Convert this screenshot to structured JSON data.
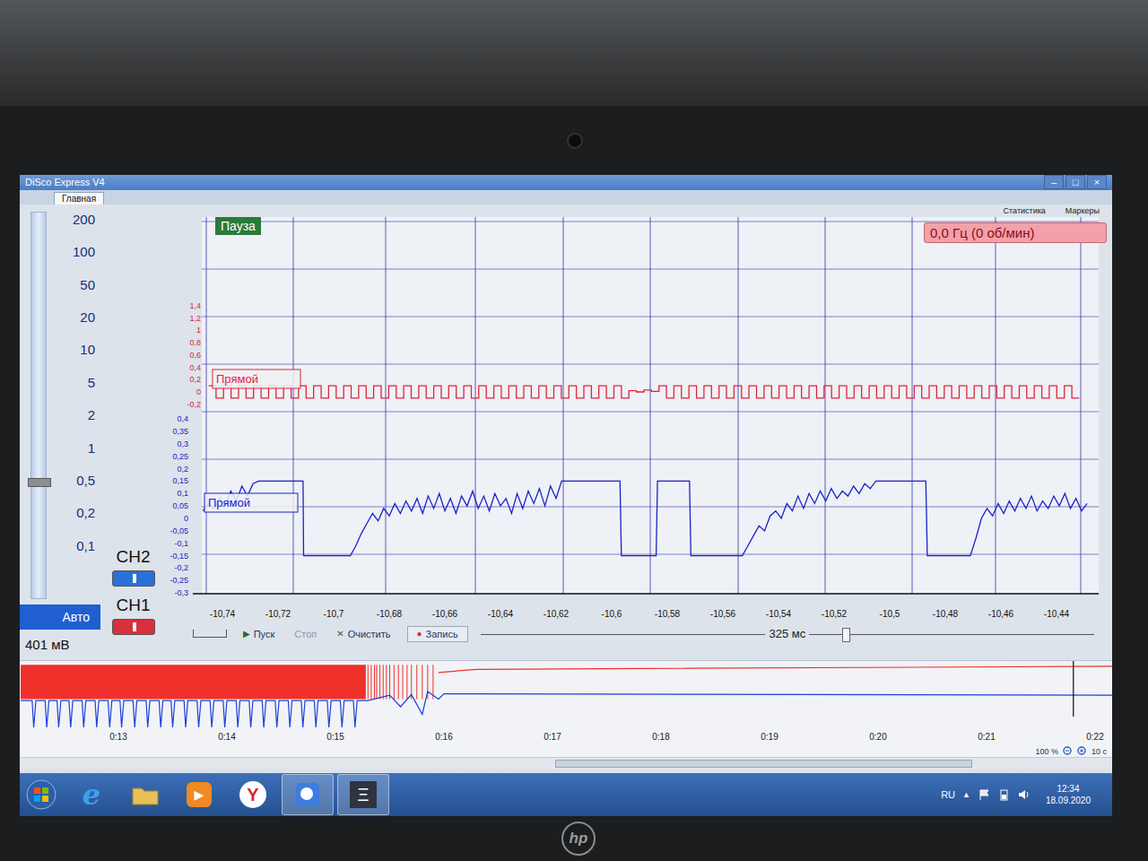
{
  "window": {
    "title": "DiSco Express V4",
    "controls": [
      "–",
      "□",
      "×"
    ]
  },
  "tabs": [
    {
      "label": "Главная",
      "selected": true
    }
  ],
  "top_links": [
    "Статистика",
    "Маркеры"
  ],
  "scale": {
    "labels": [
      "200",
      "100",
      "50",
      "20",
      "10",
      "5",
      "2",
      "1",
      "0,5",
      "0,2",
      "0,1"
    ],
    "level": 0.3,
    "auto_button": "Авто",
    "reading": "401 мВ"
  },
  "channels": [
    {
      "name": "CH2",
      "on": true,
      "color": "#2b6fd8"
    },
    {
      "name": "CH1",
      "on": true,
      "color": "#d8303c"
    }
  ],
  "plot": {
    "status_badge": "Пауза",
    "frequency": "0,0 Гц (0 об/мин)",
    "x_ticks": [
      "-10,74",
      "-10,72",
      "-10,7",
      "-10,68",
      "-10,66",
      "-10,64",
      "-10,62",
      "-10,6",
      "-10,58",
      "-10,56",
      "-10,54",
      "-10,52",
      "-10,5",
      "-10,48",
      "-10,46",
      "-10,44"
    ],
    "red_axis": [
      "1,4",
      "1,2",
      "1",
      "0,8",
      "0,6",
      "0,4",
      "0,2",
      "0",
      "-0,2"
    ],
    "blue_axis": [
      "0,4",
      "0,35",
      "0,3",
      "0,25",
      "0,2",
      "0,15",
      "0,1",
      "0,05",
      "0",
      "-0,05",
      "-0,1",
      "-0,15",
      "-0,2",
      "-0,25",
      "-0,3"
    ],
    "series": [
      {
        "name": "Прямой",
        "axis": "red",
        "color": "#e2233c",
        "t0": -10.745,
        "step": 0.0027,
        "values": [
          0.1,
          -0.1,
          0.1,
          -0.1,
          0.1,
          -0.1,
          0.1,
          -0.1,
          0.1,
          -0.1,
          0.1,
          -0.1,
          0.1,
          -0.1,
          0.1,
          -0.1,
          0.1,
          -0.1,
          0.1,
          -0.1,
          0.1,
          -0.1,
          0.1,
          -0.1,
          0.1,
          -0.1,
          0.1,
          -0.1,
          0.1,
          -0.1,
          0.1,
          -0.1,
          0.1,
          -0.1,
          0.1,
          -0.1,
          0.1,
          -0.1,
          0.1,
          -0.1,
          0.1,
          -0.1,
          0.1,
          -0.1,
          0.1,
          -0.1,
          0.1,
          -0.1,
          0.1,
          -0.1,
          0.1,
          -0.1,
          0.1,
          -0.1,
          0.1,
          -0.1,
          0.02,
          0.0,
          0.03,
          0.01,
          0.1,
          -0.1,
          0.1,
          -0.1,
          0.1,
          -0.1,
          0.1,
          -0.1,
          0.1,
          -0.1,
          0.1,
          -0.1,
          0.1,
          -0.1,
          0.1,
          -0.1,
          0.1,
          -0.1,
          0.1,
          -0.1,
          0.1,
          -0.1,
          0.1,
          -0.1,
          0.1,
          -0.1,
          0.1,
          -0.1,
          0.1,
          -0.1,
          0.1,
          -0.1,
          0.1,
          -0.1,
          0.1,
          -0.1,
          0.1,
          -0.1,
          0.1,
          -0.1,
          0.1,
          -0.1,
          0.1,
          -0.1,
          0.1,
          -0.1,
          0.1,
          -0.1,
          0.1,
          -0.1,
          0.1,
          -0.1,
          0.1,
          -0.1,
          0.1,
          -0.1
        ]
      },
      {
        "name": "Прямой",
        "axis": "blue",
        "color": "#1a22c8",
        "points": [
          [
            -10.747,
            0.03
          ],
          [
            -10.745,
            0.06
          ],
          [
            -10.743,
            0.04
          ],
          [
            -10.741,
            0.08
          ],
          [
            -10.739,
            0.05
          ],
          [
            -10.737,
            0.11
          ],
          [
            -10.735,
            0.07
          ],
          [
            -10.733,
            0.13
          ],
          [
            -10.731,
            0.09
          ],
          [
            -10.729,
            0.14
          ],
          [
            -10.727,
            0.15
          ],
          [
            -10.711,
            0.15
          ],
          [
            -10.7108,
            -0.15
          ],
          [
            -10.694,
            -0.15
          ],
          [
            -10.692,
            -0.11
          ],
          [
            -10.69,
            -0.06
          ],
          [
            -10.688,
            -0.02
          ],
          [
            -10.686,
            0.02
          ],
          [
            -10.684,
            -0.01
          ],
          [
            -10.682,
            0.04
          ],
          [
            -10.68,
            0.01
          ],
          [
            -10.678,
            0.06
          ],
          [
            -10.676,
            0.02
          ],
          [
            -10.674,
            0.07
          ],
          [
            -10.672,
            0.03
          ],
          [
            -10.67,
            0.08
          ],
          [
            -10.668,
            0.02
          ],
          [
            -10.666,
            0.09
          ],
          [
            -10.664,
            0.04
          ],
          [
            -10.662,
            0.1
          ],
          [
            -10.66,
            0.03
          ],
          [
            -10.658,
            0.08
          ],
          [
            -10.656,
            0.02
          ],
          [
            -10.654,
            0.09
          ],
          [
            -10.652,
            0.05
          ],
          [
            -10.65,
            0.11
          ],
          [
            -10.648,
            0.04
          ],
          [
            -10.646,
            0.09
          ],
          [
            -10.644,
            0.03
          ],
          [
            -10.642,
            0.1
          ],
          [
            -10.64,
            0.05
          ],
          [
            -10.638,
            0.08
          ],
          [
            -10.636,
            0.02
          ],
          [
            -10.634,
            0.1
          ],
          [
            -10.632,
            0.04
          ],
          [
            -10.63,
            0.11
          ],
          [
            -10.628,
            0.06
          ],
          [
            -10.626,
            0.12
          ],
          [
            -10.624,
            0.05
          ],
          [
            -10.622,
            0.13
          ],
          [
            -10.62,
            0.08
          ],
          [
            -10.618,
            0.15
          ],
          [
            -10.597,
            0.15
          ],
          [
            -10.5965,
            -0.15
          ],
          [
            -10.584,
            -0.15
          ],
          [
            -10.5835,
            0.15
          ],
          [
            -10.572,
            0.15
          ],
          [
            -10.5715,
            -0.15
          ],
          [
            -10.553,
            -0.15
          ],
          [
            -10.551,
            -0.11
          ],
          [
            -10.549,
            -0.07
          ],
          [
            -10.547,
            -0.03
          ],
          [
            -10.545,
            -0.05
          ],
          [
            -10.543,
            0.01
          ],
          [
            -10.541,
            0.03
          ],
          [
            -10.539,
            0.0
          ],
          [
            -10.537,
            0.06
          ],
          [
            -10.535,
            0.03
          ],
          [
            -10.533,
            0.09
          ],
          [
            -10.531,
            0.04
          ],
          [
            -10.529,
            0.1
          ],
          [
            -10.527,
            0.06
          ],
          [
            -10.525,
            0.11
          ],
          [
            -10.523,
            0.07
          ],
          [
            -10.521,
            0.12
          ],
          [
            -10.519,
            0.08
          ],
          [
            -10.517,
            0.11
          ],
          [
            -10.515,
            0.09
          ],
          [
            -10.513,
            0.13
          ],
          [
            -10.511,
            0.1
          ],
          [
            -10.509,
            0.14
          ],
          [
            -10.507,
            0.12
          ],
          [
            -10.505,
            0.15
          ],
          [
            -10.487,
            0.15
          ],
          [
            -10.4865,
            -0.15
          ],
          [
            -10.471,
            -0.15
          ],
          [
            -10.469,
            -0.08
          ],
          [
            -10.467,
            0.0
          ],
          [
            -10.465,
            0.04
          ],
          [
            -10.463,
            0.01
          ],
          [
            -10.461,
            0.06
          ],
          [
            -10.459,
            0.02
          ],
          [
            -10.457,
            0.07
          ],
          [
            -10.455,
            0.03
          ],
          [
            -10.453,
            0.08
          ],
          [
            -10.451,
            0.04
          ],
          [
            -10.449,
            0.09
          ],
          [
            -10.447,
            0.03
          ],
          [
            -10.445,
            0.07
          ],
          [
            -10.443,
            0.04
          ],
          [
            -10.441,
            0.09
          ],
          [
            -10.439,
            0.05
          ],
          [
            -10.437,
            0.1
          ],
          [
            -10.435,
            0.04
          ],
          [
            -10.433,
            0.08
          ],
          [
            -10.431,
            0.03
          ],
          [
            -10.429,
            0.06
          ]
        ]
      }
    ]
  },
  "toolbar": {
    "buttons": [
      {
        "icon": "▶",
        "label": "Пуск",
        "disabled": false,
        "kind": "plain"
      },
      {
        "icon": "",
        "label": "Стоп",
        "disabled": true,
        "kind": "plain"
      },
      {
        "icon": "✕",
        "label": "Очистить",
        "disabled": false,
        "kind": "plain"
      },
      {
        "icon": "●",
        "label": "Запись",
        "disabled": false,
        "kind": "boxed"
      }
    ],
    "window": "325 мс",
    "level": 0.59
  },
  "overview": {
    "time_ticks": [
      "0:13",
      "0:14",
      "0:15",
      "0:16",
      "0:17",
      "0:18",
      "0:19",
      "0:20",
      "0:21",
      "0:22"
    ],
    "cursor": 21.8,
    "zoom": "100 %",
    "span": "10 с",
    "red": {
      "color": "#f0302a",
      "band": [
        12.1,
        15.28
      ],
      "top": 0.95,
      "bottom": 0.5,
      "pulses": [
        15.3,
        15.33,
        15.36,
        15.38,
        15.41,
        15.44,
        15.47,
        15.5,
        15.54,
        15.58,
        15.62,
        15.66,
        15.7,
        15.75,
        15.8,
        15.85,
        15.9
      ],
      "line": [
        [
          15.95,
          0.85
        ],
        [
          16.3,
          0.89
        ],
        [
          22.2,
          0.93
        ]
      ]
    },
    "blue": {
      "color": "#1f3fd8",
      "from": 12.1,
      "to": 15.28,
      "base": 0.48,
      "low": 0.13,
      "spikes": [
        12.22,
        12.34,
        12.45,
        12.56,
        12.68,
        12.8,
        12.92,
        13.03,
        13.15,
        13.27,
        13.39,
        13.5,
        13.62,
        13.74,
        13.86,
        13.98,
        14.1,
        14.22,
        14.34,
        14.46,
        14.58,
        14.7,
        14.82,
        14.94,
        15.06,
        15.18
      ],
      "line": [
        [
          15.3,
          0.48
        ],
        [
          15.5,
          0.55
        ],
        [
          15.6,
          0.4
        ],
        [
          15.7,
          0.56
        ],
        [
          15.8,
          0.3
        ],
        [
          15.85,
          0.6
        ],
        [
          15.95,
          0.5
        ],
        [
          16.0,
          0.57
        ],
        [
          16.3,
          0.57
        ],
        [
          22.2,
          0.55
        ]
      ]
    },
    "scrollbar": {
      "start": 0.49,
      "size": 0.38
    }
  },
  "taskbar": {
    "apps": [
      {
        "kind": "ie",
        "glyph": "e",
        "active": false
      },
      {
        "kind": "folder",
        "glyph": "",
        "active": false
      },
      {
        "kind": "media",
        "glyph": "▶",
        "active": false
      },
      {
        "kind": "yandex",
        "glyph": "Y",
        "active": false
      },
      {
        "kind": "search",
        "glyph": "",
        "active": true
      },
      {
        "kind": "disco",
        "glyph": "Ξ",
        "active": true
      }
    ],
    "lang": "RU",
    "tray": [
      "▲"
    ],
    "time": "12:34",
    "date": "18.09.2020"
  },
  "bezel": {
    "logo": "hp"
  }
}
